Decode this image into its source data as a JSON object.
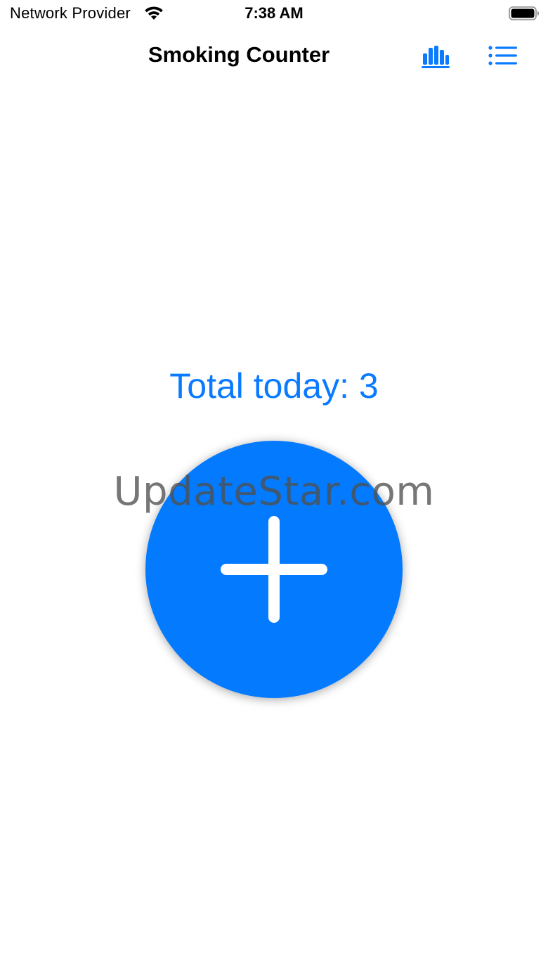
{
  "status_bar": {
    "carrier": "Network Provider",
    "time": "7:38 AM",
    "wifi_icon": "wifi-icon",
    "battery_icon": "battery-icon"
  },
  "nav": {
    "title": "Smoking Counter",
    "stats_icon": "bar-chart-icon",
    "list_icon": "list-icon"
  },
  "main": {
    "total_label": "Total today: 3",
    "add_icon": "plus-icon"
  },
  "watermark": {
    "text": "UpdateStar.com"
  },
  "colors": {
    "accent": "#047bfe",
    "background": "#ffffff",
    "text": "#000000"
  }
}
